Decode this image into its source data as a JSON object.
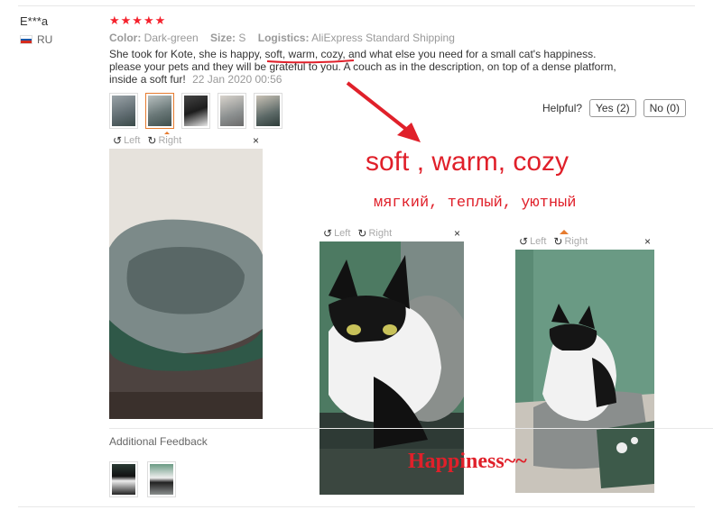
{
  "user": {
    "name": "E***a",
    "country_code": "RU"
  },
  "rating": {
    "stars": "★★★★★",
    "value": 5,
    "color": "#f5222d"
  },
  "properties": [
    {
      "label": "Color:",
      "value": "Dark-green"
    },
    {
      "label": "Size:",
      "value": "S"
    },
    {
      "label": "Logistics:",
      "value": "AliExpress Standard Shipping"
    }
  ],
  "review": {
    "text": "She took for Kote, she is happy, soft, warm, cozy, and what else you need for a small cat's happiness. please your pets and they will be grateful to you. A couch as in the description, on top of a dense platform, inside a soft fur!",
    "date": "22 Jan 2020 00:56"
  },
  "thumbnails_count": 5,
  "active_thumbnail": 2,
  "helpful": {
    "label": "Helpful?",
    "yes": "Yes (2)",
    "no": "No (0)"
  },
  "viewer": {
    "left": "Left",
    "right": "Right",
    "close": "×",
    "rotate_left_icon": "rotate-left-icon",
    "rotate_right_icon": "rotate-right-icon"
  },
  "annotations": {
    "english": "soft , warm, cozy",
    "russian": "мягкий, теплый, уютный",
    "happiness": "Happiness~~",
    "color": "#e0202a"
  },
  "additional_feedback": {
    "label": "Additional Feedback"
  },
  "colors": {
    "accent_border": "#e67b2f",
    "muted": "#999999"
  }
}
